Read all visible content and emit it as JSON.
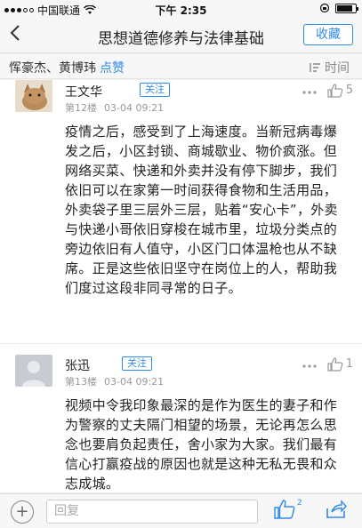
{
  "status_bar": {
    "carrier": "中国联通",
    "time": "下午 2:35",
    "battery_level": 0.85
  },
  "nav": {
    "back_glyph": "＜",
    "title": "思想道德修养与法律基础",
    "collect_label": "收藏"
  },
  "likes_bar": {
    "names": "恽豪杰、黄博玮",
    "action": "点赞",
    "sort_label": "时间"
  },
  "posts": [
    {
      "username": "王文华",
      "follow_label": "关注",
      "floor": "第12楼",
      "time": "03-04 09:21",
      "like_count": "5",
      "body": "疫情之后，感受到了上海速度。当新冠病毒爆发之后，小区封锁、商城歇业、物价疯涨。但网络买菜、快递和外卖并没有停下脚步，我们依旧可以在家第一时间获得食物和生活用品，外卖袋子里三层外三层，贴着“安心卡”，外卖与快递小哥依旧穿梭在城市里，垃圾分类点的旁边依旧有人值守，小区门口体温枪也从不缺席。正是这些依旧坚守在岗位上的人，帮助我们度过这段非同寻常的日子。"
    },
    {
      "username": "张迅",
      "follow_label": "关注",
      "floor": "第13楼",
      "time": "03-04 09:21",
      "like_count": "1",
      "body": "视频中令我印象最深的是作为医生的妻子和作为警察的丈夫隔门相望的场景，无论再怎么思念也要肩负起责任，舍小家为大家。我们最有信心打赢疫战的原因也就是这种无私无畏和众志成城。"
    }
  ],
  "bottom": {
    "plus_glyph": "+",
    "reply_placeholder": "回复",
    "like_count": "2"
  },
  "colors": {
    "accent": "#2f8be8"
  },
  "icons": [
    "signal-dots-icon",
    "wifi-icon",
    "lock-rotation-icon",
    "battery-icon",
    "back-chevron-icon",
    "sort-lines-icon",
    "more-dots-icon",
    "thumb-up-icon",
    "add-circle-icon",
    "share-icon"
  ]
}
